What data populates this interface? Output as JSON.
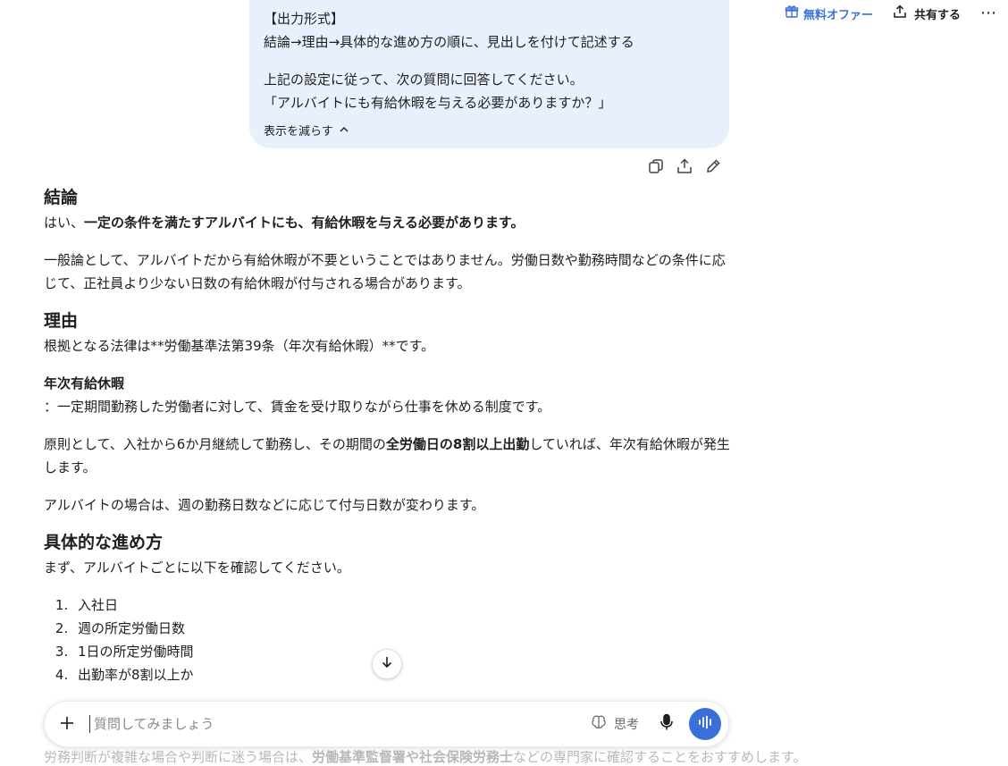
{
  "topbar": {
    "offer_label": "無料オファー",
    "share_label": "共有する",
    "more_label": "⋯"
  },
  "user_message": {
    "lines": [
      "【出力形式】",
      "結論→理由→具体的な進め方の順に、見出しを付けて記述する",
      "上記の設定に従って、次の質問に回答してください。",
      "「アルバイトにも有給休暇を与える必要がありますか？」"
    ],
    "collapse_label": "表示を減らす"
  },
  "answer": {
    "h_conclusion": "結論",
    "c1_pre": "はい、",
    "c1_bold": "一定の条件を満たすアルバイトにも、有給休暇を与える必要があります。",
    "c2": "一般論として、アルバイトだから有給休暇が不要ということではありません。労働日数や勤務時間などの条件に応じて、正社員より少ない日数の有給休暇が付与される場合があります。",
    "h_reason": "理由",
    "r1": "根拠となる法律は**労働基準法第39条（年次有給休暇）**です。",
    "h_annual": "年次有給休暇",
    "r2": "：一定期間勤務した労働者に対して、賃金を受け取りながら仕事を休める制度です。",
    "r3_pre": "原則として、入社から6か月継続して勤務し、その期間の",
    "r3_bold": "全労働日の8割以上出勤",
    "r3_post": "していれば、年次有給休暇が発生します。",
    "r4": "アルバイトの場合は、週の勤務日数などに応じて付与日数が変わります。",
    "h_steps": "具体的な進め方",
    "s1": "まず、アルバイトごとに以下を確認してください。",
    "steps": [
      "入社日",
      "週の所定労働日数",
      "1日の所定労働時間",
      "出勤率が8割以上か"
    ],
    "faded_pre": "労務判断が複雑な場合や判断に迷う場合は、",
    "faded_bold": "労働基準監督署や社会保険労務士",
    "faded_post": "などの専門家に確認することをおすすめします。"
  },
  "composer": {
    "placeholder": "質問してみましょう",
    "think_label": "思考"
  },
  "colors": {
    "accent": "#3b6fd8",
    "bubble": "#e8f0fe"
  }
}
